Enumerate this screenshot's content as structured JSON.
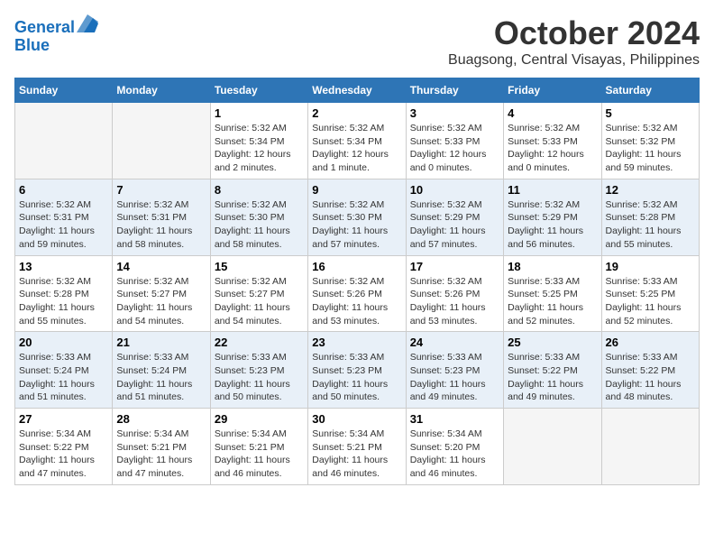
{
  "header": {
    "logo_line1": "General",
    "logo_line2": "Blue",
    "month": "October 2024",
    "location": "Buagsong, Central Visayas, Philippines"
  },
  "columns": [
    "Sunday",
    "Monday",
    "Tuesday",
    "Wednesday",
    "Thursday",
    "Friday",
    "Saturday"
  ],
  "weeks": [
    [
      {
        "day": "",
        "sunrise": "",
        "sunset": "",
        "daylight": ""
      },
      {
        "day": "",
        "sunrise": "",
        "sunset": "",
        "daylight": ""
      },
      {
        "day": "1",
        "sunrise": "Sunrise: 5:32 AM",
        "sunset": "Sunset: 5:34 PM",
        "daylight": "Daylight: 12 hours and 2 minutes."
      },
      {
        "day": "2",
        "sunrise": "Sunrise: 5:32 AM",
        "sunset": "Sunset: 5:34 PM",
        "daylight": "Daylight: 12 hours and 1 minute."
      },
      {
        "day": "3",
        "sunrise": "Sunrise: 5:32 AM",
        "sunset": "Sunset: 5:33 PM",
        "daylight": "Daylight: 12 hours and 0 minutes."
      },
      {
        "day": "4",
        "sunrise": "Sunrise: 5:32 AM",
        "sunset": "Sunset: 5:33 PM",
        "daylight": "Daylight: 12 hours and 0 minutes."
      },
      {
        "day": "5",
        "sunrise": "Sunrise: 5:32 AM",
        "sunset": "Sunset: 5:32 PM",
        "daylight": "Daylight: 11 hours and 59 minutes."
      }
    ],
    [
      {
        "day": "6",
        "sunrise": "Sunrise: 5:32 AM",
        "sunset": "Sunset: 5:31 PM",
        "daylight": "Daylight: 11 hours and 59 minutes."
      },
      {
        "day": "7",
        "sunrise": "Sunrise: 5:32 AM",
        "sunset": "Sunset: 5:31 PM",
        "daylight": "Daylight: 11 hours and 58 minutes."
      },
      {
        "day": "8",
        "sunrise": "Sunrise: 5:32 AM",
        "sunset": "Sunset: 5:30 PM",
        "daylight": "Daylight: 11 hours and 58 minutes."
      },
      {
        "day": "9",
        "sunrise": "Sunrise: 5:32 AM",
        "sunset": "Sunset: 5:30 PM",
        "daylight": "Daylight: 11 hours and 57 minutes."
      },
      {
        "day": "10",
        "sunrise": "Sunrise: 5:32 AM",
        "sunset": "Sunset: 5:29 PM",
        "daylight": "Daylight: 11 hours and 57 minutes."
      },
      {
        "day": "11",
        "sunrise": "Sunrise: 5:32 AM",
        "sunset": "Sunset: 5:29 PM",
        "daylight": "Daylight: 11 hours and 56 minutes."
      },
      {
        "day": "12",
        "sunrise": "Sunrise: 5:32 AM",
        "sunset": "Sunset: 5:28 PM",
        "daylight": "Daylight: 11 hours and 55 minutes."
      }
    ],
    [
      {
        "day": "13",
        "sunrise": "Sunrise: 5:32 AM",
        "sunset": "Sunset: 5:28 PM",
        "daylight": "Daylight: 11 hours and 55 minutes."
      },
      {
        "day": "14",
        "sunrise": "Sunrise: 5:32 AM",
        "sunset": "Sunset: 5:27 PM",
        "daylight": "Daylight: 11 hours and 54 minutes."
      },
      {
        "day": "15",
        "sunrise": "Sunrise: 5:32 AM",
        "sunset": "Sunset: 5:27 PM",
        "daylight": "Daylight: 11 hours and 54 minutes."
      },
      {
        "day": "16",
        "sunrise": "Sunrise: 5:32 AM",
        "sunset": "Sunset: 5:26 PM",
        "daylight": "Daylight: 11 hours and 53 minutes."
      },
      {
        "day": "17",
        "sunrise": "Sunrise: 5:32 AM",
        "sunset": "Sunset: 5:26 PM",
        "daylight": "Daylight: 11 hours and 53 minutes."
      },
      {
        "day": "18",
        "sunrise": "Sunrise: 5:33 AM",
        "sunset": "Sunset: 5:25 PM",
        "daylight": "Daylight: 11 hours and 52 minutes."
      },
      {
        "day": "19",
        "sunrise": "Sunrise: 5:33 AM",
        "sunset": "Sunset: 5:25 PM",
        "daylight": "Daylight: 11 hours and 52 minutes."
      }
    ],
    [
      {
        "day": "20",
        "sunrise": "Sunrise: 5:33 AM",
        "sunset": "Sunset: 5:24 PM",
        "daylight": "Daylight: 11 hours and 51 minutes."
      },
      {
        "day": "21",
        "sunrise": "Sunrise: 5:33 AM",
        "sunset": "Sunset: 5:24 PM",
        "daylight": "Daylight: 11 hours and 51 minutes."
      },
      {
        "day": "22",
        "sunrise": "Sunrise: 5:33 AM",
        "sunset": "Sunset: 5:23 PM",
        "daylight": "Daylight: 11 hours and 50 minutes."
      },
      {
        "day": "23",
        "sunrise": "Sunrise: 5:33 AM",
        "sunset": "Sunset: 5:23 PM",
        "daylight": "Daylight: 11 hours and 50 minutes."
      },
      {
        "day": "24",
        "sunrise": "Sunrise: 5:33 AM",
        "sunset": "Sunset: 5:23 PM",
        "daylight": "Daylight: 11 hours and 49 minutes."
      },
      {
        "day": "25",
        "sunrise": "Sunrise: 5:33 AM",
        "sunset": "Sunset: 5:22 PM",
        "daylight": "Daylight: 11 hours and 49 minutes."
      },
      {
        "day": "26",
        "sunrise": "Sunrise: 5:33 AM",
        "sunset": "Sunset: 5:22 PM",
        "daylight": "Daylight: 11 hours and 48 minutes."
      }
    ],
    [
      {
        "day": "27",
        "sunrise": "Sunrise: 5:34 AM",
        "sunset": "Sunset: 5:22 PM",
        "daylight": "Daylight: 11 hours and 47 minutes."
      },
      {
        "day": "28",
        "sunrise": "Sunrise: 5:34 AM",
        "sunset": "Sunset: 5:21 PM",
        "daylight": "Daylight: 11 hours and 47 minutes."
      },
      {
        "day": "29",
        "sunrise": "Sunrise: 5:34 AM",
        "sunset": "Sunset: 5:21 PM",
        "daylight": "Daylight: 11 hours and 46 minutes."
      },
      {
        "day": "30",
        "sunrise": "Sunrise: 5:34 AM",
        "sunset": "Sunset: 5:21 PM",
        "daylight": "Daylight: 11 hours and 46 minutes."
      },
      {
        "day": "31",
        "sunrise": "Sunrise: 5:34 AM",
        "sunset": "Sunset: 5:20 PM",
        "daylight": "Daylight: 11 hours and 46 minutes."
      },
      {
        "day": "",
        "sunrise": "",
        "sunset": "",
        "daylight": ""
      },
      {
        "day": "",
        "sunrise": "",
        "sunset": "",
        "daylight": ""
      }
    ]
  ]
}
